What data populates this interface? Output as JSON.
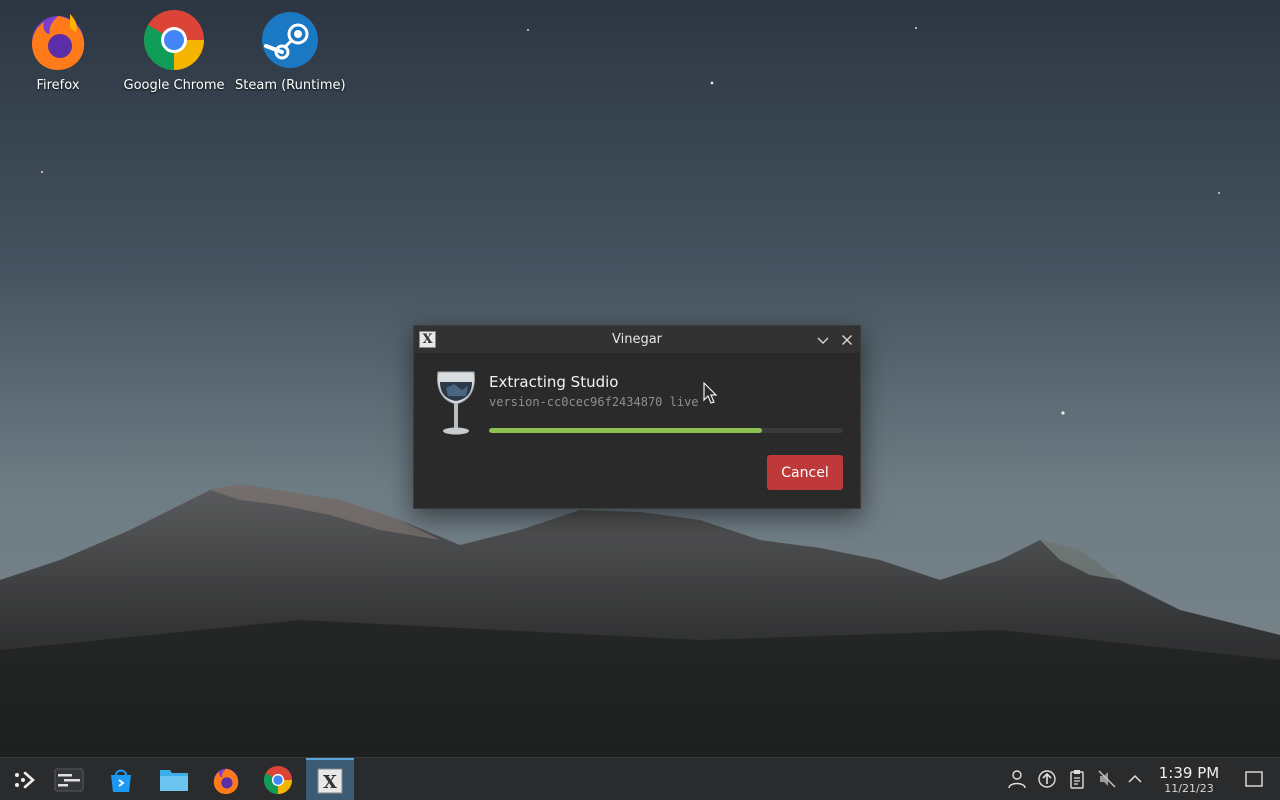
{
  "desktop": {
    "icons": [
      {
        "label": "Firefox",
        "icon": "firefox-icon"
      },
      {
        "label": "Google Chrome",
        "icon": "chrome-icon"
      },
      {
        "label": "Steam (Runtime)",
        "icon": "steam-icon"
      }
    ]
  },
  "dialog": {
    "title": "Vinegar",
    "status_title": "Extracting Studio",
    "version": "version-cc0cec96f2434870 live",
    "progress": 0.77,
    "cancel_label": "Cancel"
  },
  "taskbar": {
    "items": [
      "launcher-icon",
      "task-manager-icon",
      "discover-icon",
      "file-manager-icon",
      "firefox-icon",
      "chrome-icon",
      "vinegar-icon"
    ],
    "active_item": "vinegar-icon",
    "tray": [
      "user-icon",
      "update-icon",
      "clipboard-icon",
      "volume-muted-icon",
      "chevron-up-icon"
    ],
    "clock_time": "1:39 PM",
    "clock_date": "11/21/23"
  },
  "colors": {
    "accent_green": "#8cc051",
    "cancel_red": "#c0393a",
    "taskbar_active": "#3b5a73"
  }
}
